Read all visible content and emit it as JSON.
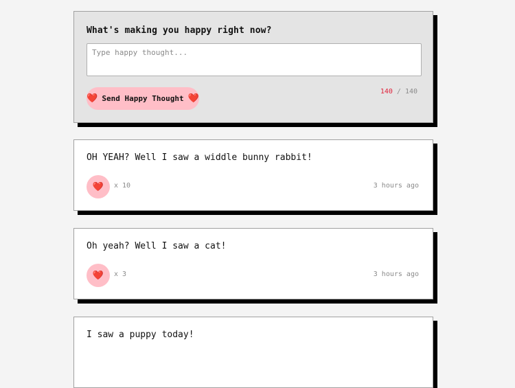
{
  "composer": {
    "title": "What's making you happy right now?",
    "input_placeholder": "Type happy thought...",
    "input_value": "",
    "send_label": "Send Happy Thought",
    "heart_icon": "❤️",
    "char_count_current": "140",
    "char_count_separator": " / ",
    "char_count_max": "140"
  },
  "colors": {
    "background": "#f4f4f4",
    "composer_bg": "#e4e4e4",
    "accent_pink": "#ffbec7",
    "heart_red": "#e0213a",
    "muted_text": "#8a8a8a"
  },
  "thoughts": [
    {
      "message": "OH YEAH? Well I saw a widdle bunny rabbit!",
      "heart_icon": "❤️",
      "likes": "x 10",
      "time": "3 hours ago"
    },
    {
      "message": "Oh yeah? Well I saw a cat!",
      "heart_icon": "❤️",
      "likes": "x 3",
      "time": "3 hours ago"
    },
    {
      "message": "I saw a puppy today!"
    }
  ]
}
